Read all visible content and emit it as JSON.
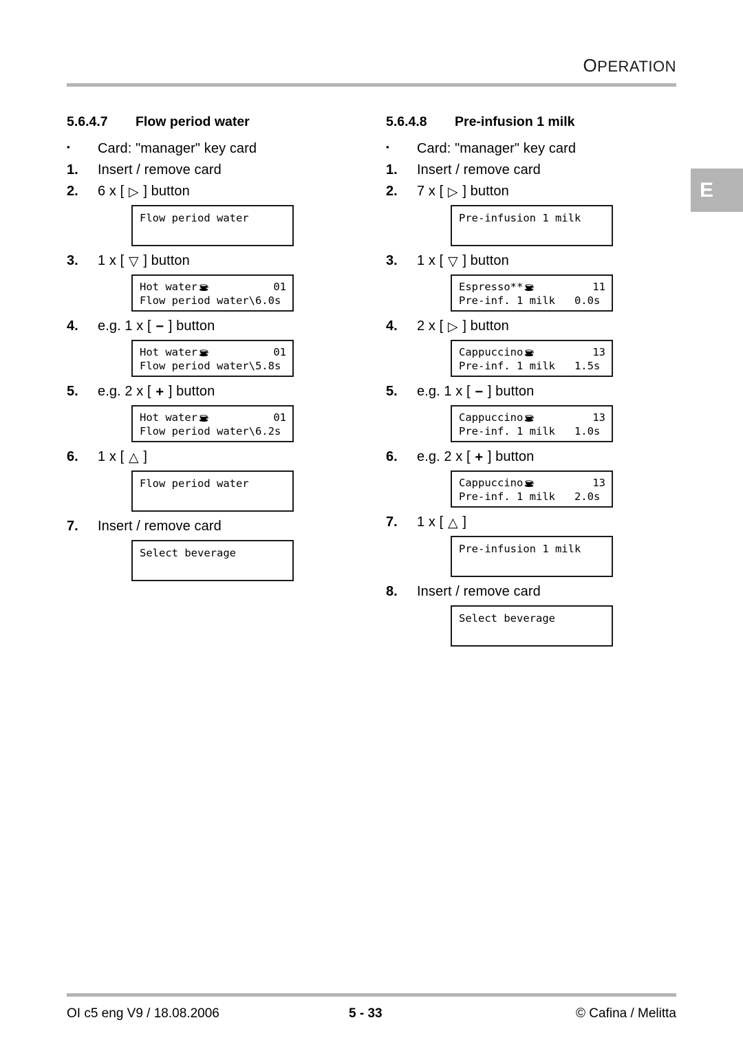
{
  "header": {
    "title_first": "O",
    "title_rest": "PERATION"
  },
  "side_tab": {
    "label": "E",
    "color": "#b4b4b4"
  },
  "columns": [
    {
      "heading": {
        "number": "5.6.4.7",
        "title": "Flow period water"
      },
      "steps": [
        {
          "marker": "▪",
          "marker_type": "bullet",
          "text": "Card: \"manager\" key card"
        },
        {
          "marker": "1.",
          "marker_type": "number",
          "text": "Insert / remove card"
        },
        {
          "marker": "2.",
          "marker_type": "number",
          "prefix": "6 x [ ",
          "symbol": "▷",
          "suffix": " ] button",
          "display": {
            "kind": "one-line",
            "line1_left": "Flow period water",
            "line1_right": "",
            "line1_cup": false
          }
        },
        {
          "marker": "3.",
          "marker_type": "number",
          "prefix": "1 x [ ",
          "symbol": "▽",
          "suffix": " ] button",
          "display": {
            "kind": "two-line",
            "line1_left": "Hot water",
            "line1_cup": true,
            "line1_right": "01",
            "line2_left": "Flow period water\\6.0s"
          }
        },
        {
          "marker": "4.",
          "marker_type": "number",
          "prefix": "e.g. 1 x [ ",
          "symbol": "−",
          "suffix": " ] button",
          "display": {
            "kind": "two-line",
            "line1_left": "Hot water",
            "line1_cup": true,
            "line1_right": "01",
            "line2_left": "Flow period water\\5.8s"
          }
        },
        {
          "marker": "5.",
          "marker_type": "number",
          "prefix": "e.g. 2 x [ ",
          "symbol": "+",
          "suffix": " ] button",
          "display": {
            "kind": "two-line",
            "line1_left": "Hot water",
            "line1_cup": true,
            "line1_right": "01",
            "line2_left": "Flow period water\\6.2s"
          }
        },
        {
          "marker": "6.",
          "marker_type": "number",
          "prefix": "1 x [ ",
          "symbol": "△",
          "suffix": " ]",
          "display": {
            "kind": "one-line",
            "line1_left": "Flow period water",
            "line1_right": "",
            "line1_cup": false
          }
        },
        {
          "marker": "7.",
          "marker_type": "number",
          "text": "Insert / remove card",
          "display": {
            "kind": "one-line",
            "line1_left": "Select beverage",
            "line1_right": "",
            "line1_cup": false
          }
        }
      ]
    },
    {
      "heading": {
        "number": "5.6.4.8",
        "title": "Pre-infusion 1 milk"
      },
      "steps": [
        {
          "marker": "▪",
          "marker_type": "bullet",
          "text": "Card: \"manager\" key card"
        },
        {
          "marker": "1.",
          "marker_type": "number",
          "text": "Insert / remove card"
        },
        {
          "marker": "2.",
          "marker_type": "number",
          "prefix": "7 x [ ",
          "symbol": "▷",
          "suffix": " ] button",
          "display": {
            "kind": "one-line",
            "line1_left": "Pre-infusion 1 milk",
            "line1_right": "",
            "line1_cup": false
          }
        },
        {
          "marker": "3.",
          "marker_type": "number",
          "prefix": "1 x [ ",
          "symbol": "▽",
          "suffix": " ] button",
          "display": {
            "kind": "two-line",
            "line1_left": "Espresso**",
            "line1_cup": true,
            "line1_right": "11",
            "line2_left": "Pre-inf. 1 milk   0.0s"
          }
        },
        {
          "marker": "4.",
          "marker_type": "number",
          "prefix": "2 x [ ",
          "symbol": "▷",
          "suffix": " ] button",
          "display": {
            "kind": "two-line",
            "line1_left": "Cappuccino",
            "line1_cup": true,
            "line1_right": "13",
            "line2_left": "Pre-inf. 1 milk   1.5s"
          }
        },
        {
          "marker": "5.",
          "marker_type": "number",
          "prefix": "e.g. 1 x [ ",
          "symbol": "−",
          "suffix": " ] button",
          "display": {
            "kind": "two-line",
            "line1_left": "Cappuccino",
            "line1_cup": true,
            "line1_right": "13",
            "line2_left": "Pre-inf. 1 milk   1.0s"
          }
        },
        {
          "marker": "6.",
          "marker_type": "number",
          "prefix": "e.g. 2 x [ ",
          "symbol": "+",
          "suffix": " ] button",
          "display": {
            "kind": "two-line",
            "line1_left": "Cappuccino",
            "line1_cup": true,
            "line1_right": "13",
            "line2_left": "Pre-inf. 1 milk   2.0s"
          }
        },
        {
          "marker": "7.",
          "marker_type": "number",
          "prefix": "1 x [ ",
          "symbol": "△",
          "suffix": " ]",
          "display": {
            "kind": "one-line",
            "line1_left": "Pre-infusion 1 milk",
            "line1_right": "",
            "line1_cup": false
          }
        },
        {
          "marker": "8.",
          "marker_type": "number",
          "text": "Insert / remove card",
          "display": {
            "kind": "one-line",
            "line1_left": "Select beverage",
            "line1_right": "",
            "line1_cup": false
          }
        }
      ]
    }
  ],
  "footer": {
    "left": "OI c5 eng V9 / 18.08.2006",
    "center": "5 - 33",
    "right": "© Cafina / Melitta"
  }
}
